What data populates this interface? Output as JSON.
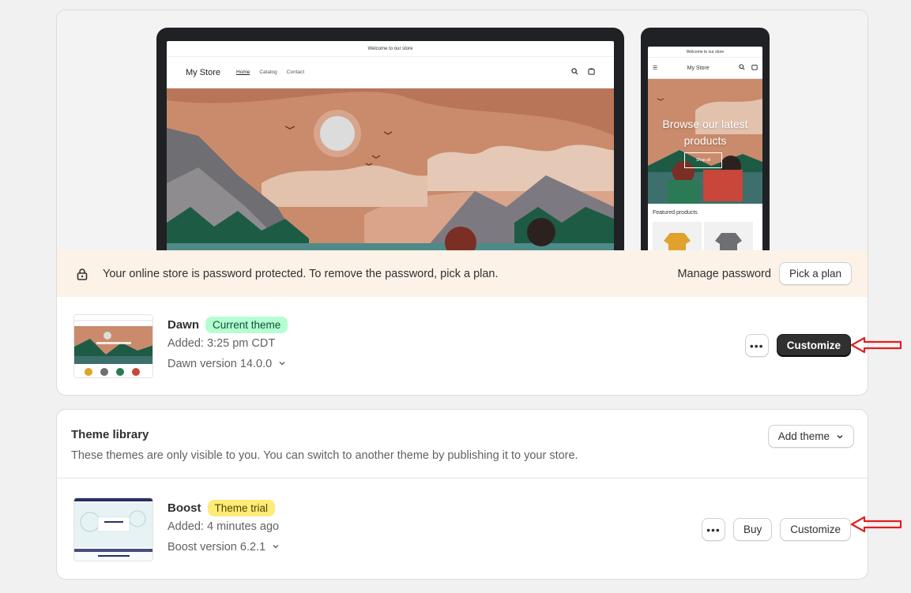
{
  "preview": {
    "desktop": {
      "announcement": "Welcome to our store",
      "store_name": "My Store",
      "nav": [
        "Home",
        "Catalog",
        "Contact"
      ]
    },
    "mobile": {
      "announcement": "Welcome to our store",
      "store_name": "My Store",
      "hero_text": "Browse our latest products",
      "hero_button": "Shop all",
      "featured_title": "Featured products"
    }
  },
  "password_banner": {
    "message": "Your online store is password protected. To remove the password, pick a plan.",
    "manage_label": "Manage password",
    "pick_plan_label": "Pick a plan"
  },
  "current_theme": {
    "name": "Dawn",
    "badge": "Current theme",
    "added": "Added: 3:25 pm CDT",
    "version": "Dawn version 14.0.0",
    "more_label": "•••",
    "customize_label": "Customize"
  },
  "library": {
    "title": "Theme library",
    "description": "These themes are only visible to you. You can switch to another theme by publishing it to your store.",
    "add_theme_label": "Add theme",
    "themes": [
      {
        "name": "Boost",
        "badge": "Theme trial",
        "added": "Added: 4 minutes ago",
        "version": "Boost version 6.2.1",
        "more_label": "•••",
        "buy_label": "Buy",
        "customize_label": "Customize"
      }
    ]
  },
  "colors": {
    "page_bg": "#f1f1f1",
    "banner_bg": "#fdf2e7",
    "badge_current": "#b4fed2",
    "badge_trial": "#ffeb78",
    "primary_button": "#303030",
    "annotation_arrow": "#e02020"
  }
}
